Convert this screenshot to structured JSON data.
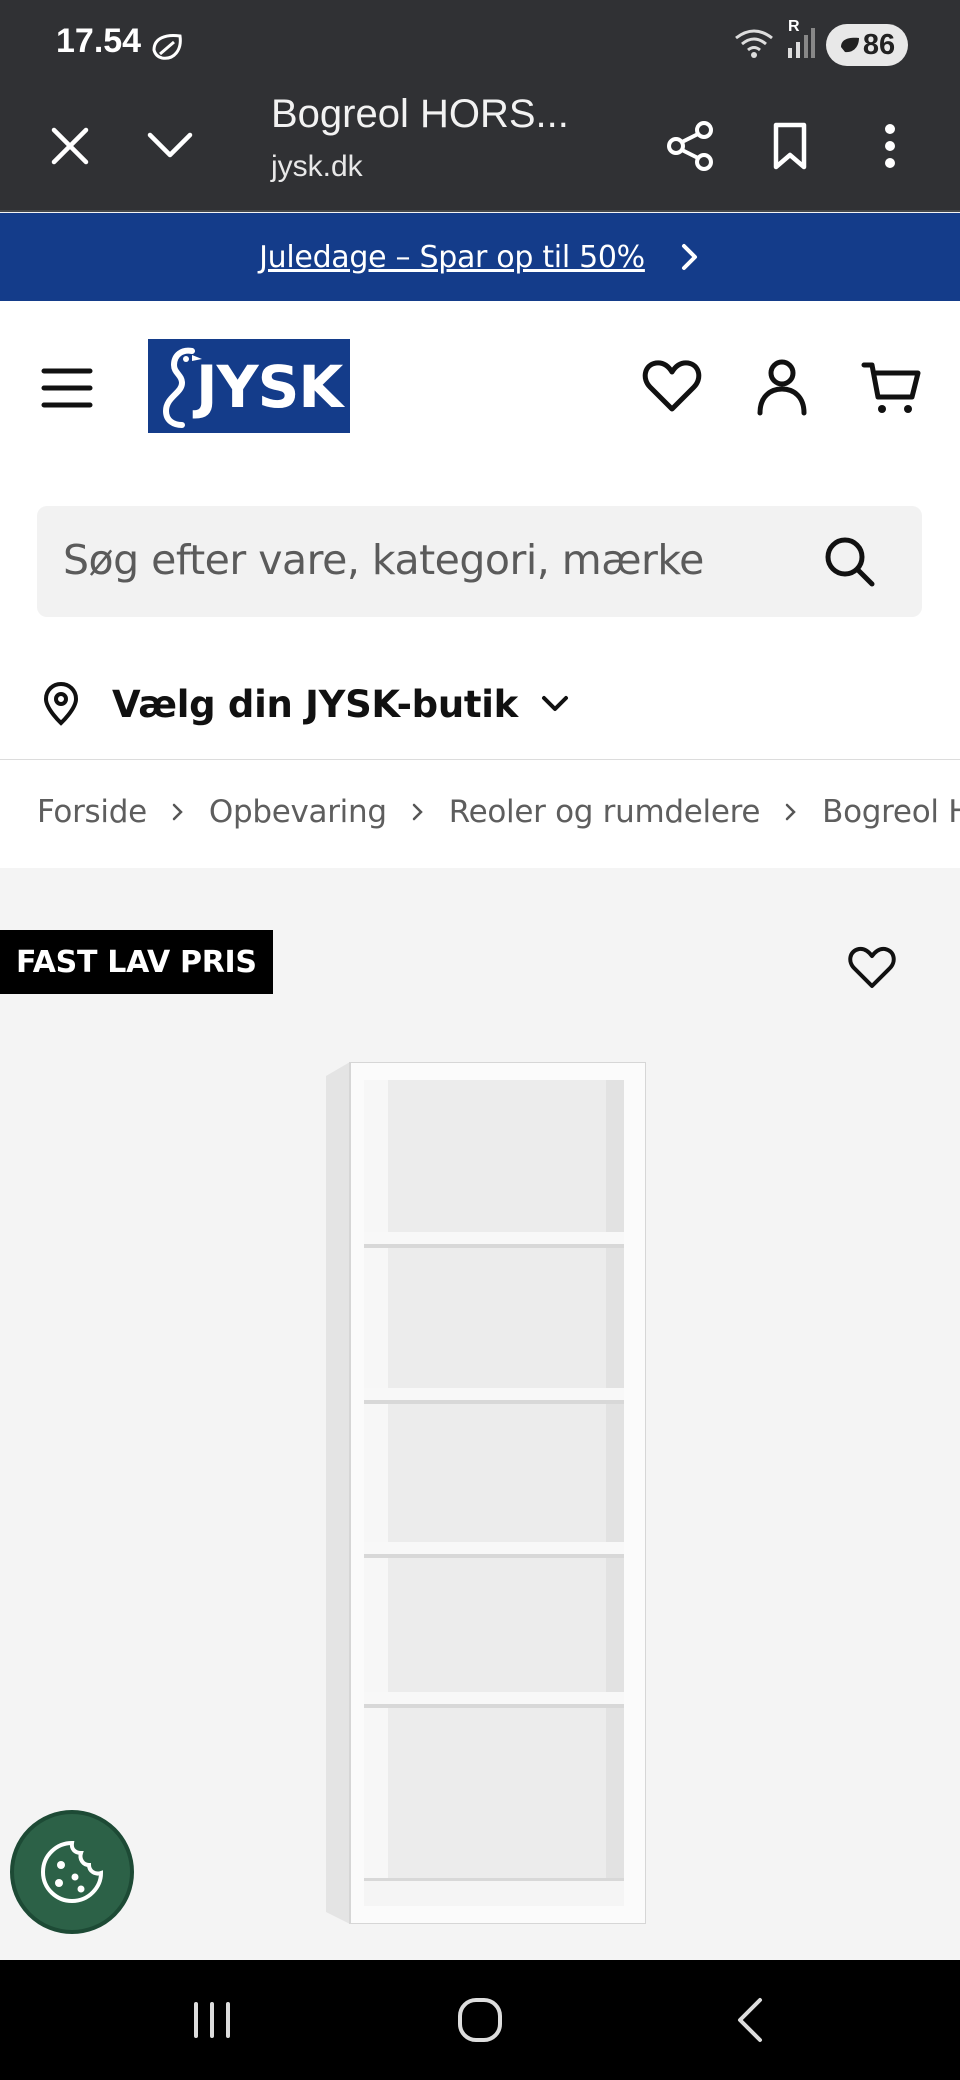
{
  "status_bar": {
    "time": "17.54",
    "battery": "86",
    "network_label": "R"
  },
  "browser": {
    "page_title": "Bogreol HORS...",
    "domain": "jysk.dk"
  },
  "promo": {
    "text": "Juledage – Spar op til 50%"
  },
  "header": {
    "logo_text": "JYSK",
    "search_placeholder": "Søg efter vare, kategori, mærke",
    "store_label": "Vælg din JYSK-butik"
  },
  "breadcrumb": {
    "items": [
      "Forside",
      "Opbevaring",
      "Reoler og rumdelere",
      "Bogreol HORSENS"
    ]
  },
  "product": {
    "badge": "FAST LAV PRIS"
  },
  "colors": {
    "brand_blue": "#143c8a",
    "browser_bg": "#303134",
    "cookie_green": "#2c6147"
  }
}
